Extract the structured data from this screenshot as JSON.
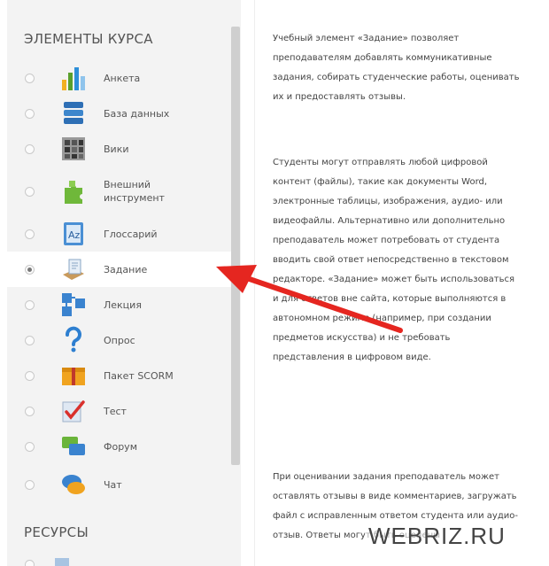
{
  "left_panel": {
    "course_elements_title": "ЭЛЕМЕНТЫ КУРСА",
    "resources_title": "РЕСУРСЫ",
    "items": [
      {
        "label": "Анкета",
        "icon": "survey-bars-icon",
        "selected": false
      },
      {
        "label": "База данных",
        "icon": "database-icon",
        "selected": false
      },
      {
        "label": "Вики",
        "icon": "wiki-icon",
        "selected": false
      },
      {
        "label": "Внешний инструмент",
        "icon": "puzzle-icon",
        "selected": false
      },
      {
        "label": "Глоссарий",
        "icon": "glossary-icon",
        "selected": false
      },
      {
        "label": "Задание",
        "icon": "assignment-icon",
        "selected": true
      },
      {
        "label": "Лекция",
        "icon": "lesson-icon",
        "selected": false
      },
      {
        "label": "Опрос",
        "icon": "question-mark-icon",
        "selected": false
      },
      {
        "label": "Пакет SCORM",
        "icon": "scorm-package-icon",
        "selected": false
      },
      {
        "label": "Тест",
        "icon": "quiz-icon",
        "selected": false
      },
      {
        "label": "Форум",
        "icon": "forum-icon",
        "selected": false
      },
      {
        "label": "Чат",
        "icon": "chat-icon",
        "selected": false
      }
    ]
  },
  "description": {
    "p1": "Учебный элемент «Задание» позволяет преподавателям добавлять коммуникативные задания, собирать студенческие работы, оценивать их и предоставлять отзывы.",
    "p2": "Студенты могут отправлять любой цифровой контент (файлы), такие как документы Word, электронные таблицы, изображения, аудио- или видеофайлы. Альтернативно или дополнительно преподаватель может потребовать от студента вводить свой ответ непосредственно в текстовом редакторе. «Задание» может быть использоваться и для ответов вне сайта, которые выполняются в автономном режиме (например, при создании предметов искусства) и не требовать представления в цифровом виде.",
    "p3": "При оценивании задания преподаватель может оставлять отзывы в виде комментариев, загружать файл с исправленным ответом студента или аудио-отзыв. Ответы могут быть оценены"
  },
  "watermark": "WEBRIZ.RU",
  "colors": {
    "arrow": "#e52620",
    "panel": "#f3f3f3",
    "selected_row": "#ffffff"
  }
}
